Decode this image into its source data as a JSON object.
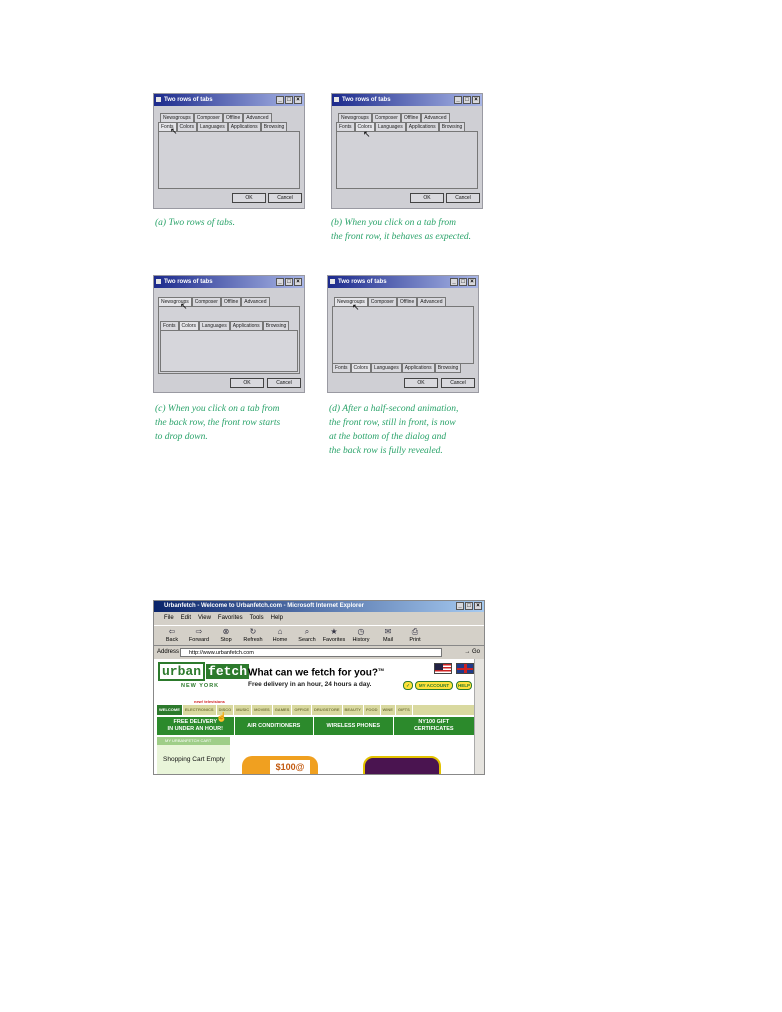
{
  "dialogs": [
    {
      "title": "Two rows of tabs",
      "back_row": [
        "Newsgroups",
        "Composer",
        "Offline",
        "Advanced"
      ],
      "front_row": [
        "Fonts",
        "Colors",
        "Languages",
        "Applications",
        "Browsing"
      ],
      "ok": "OK",
      "cancel": "Cancel",
      "caption": "(a) Two rows of tabs."
    },
    {
      "title": "Two rows of tabs",
      "back_row": [
        "Newsgroups",
        "Composer",
        "Offline",
        "Advanced"
      ],
      "front_row": [
        "Fonts",
        "Colors",
        "Languages",
        "Applications",
        "Browsing"
      ],
      "ok": "OK",
      "cancel": "Cancel",
      "caption": "(b) When you click on a tab from\nthe front row, it behaves as expected."
    },
    {
      "title": "Two rows of tabs",
      "back_row": [
        "Newsgroups",
        "Composer",
        "Offline",
        "Advanced"
      ],
      "front_row": [
        "Fonts",
        "Colors",
        "Languages",
        "Applications",
        "Browsing"
      ],
      "ok": "OK",
      "cancel": "Cancel",
      "caption": "(c) When you click on a tab from\nthe back row, the front row starts\nto drop down."
    },
    {
      "title": "Two rows of tabs",
      "back_row": [
        "Newsgroups",
        "Composer",
        "Offline",
        "Advanced"
      ],
      "front_row": [
        "Fonts",
        "Colors",
        "Languages",
        "Applications",
        "Browsing"
      ],
      "ok": "OK",
      "cancel": "Cancel",
      "caption": "(d) After a half-second animation,\nthe front row, still in front, is now\nat the bottom of the dialog and\nthe back row is fully revealed."
    }
  ],
  "browser": {
    "title": "Urbanfetch - Welcome to Urbanfetch.com - Microsoft Internet Explorer",
    "menu": [
      "File",
      "Edit",
      "View",
      "Favorites",
      "Tools",
      "Help"
    ],
    "toolbar": [
      {
        "label": "Back",
        "icon": "back-arrow-icon",
        "glyph": "⇦"
      },
      {
        "label": "Forward",
        "icon": "forward-arrow-icon",
        "glyph": "⇨"
      },
      {
        "label": "Stop",
        "icon": "stop-icon",
        "glyph": "⊗"
      },
      {
        "label": "Refresh",
        "icon": "refresh-icon",
        "glyph": "↻"
      },
      {
        "label": "Home",
        "icon": "home-icon",
        "glyph": "⌂"
      },
      {
        "label": "Search",
        "icon": "search-icon",
        "glyph": "⌕"
      },
      {
        "label": "Favorites",
        "icon": "favorites-icon",
        "glyph": "★"
      },
      {
        "label": "History",
        "icon": "history-icon",
        "glyph": "◷"
      },
      {
        "label": "Mail",
        "icon": "mail-icon",
        "glyph": "✉"
      },
      {
        "label": "Print",
        "icon": "print-icon",
        "glyph": "⎙"
      }
    ],
    "address_label": "Address",
    "address_value": "http://www.urbanfetch.com",
    "go_label": "Go",
    "page": {
      "logo_left": "urban",
      "logo_right": "fetch",
      "logo_sub": "NEW YORK",
      "headline": "What can we fetch for you?",
      "tm": "TM",
      "subline": "Free delivery in an hour, 24 hours a day.",
      "my_account": "MY ACCOUNT",
      "help": "HELP",
      "nav_items": [
        "WELCOME",
        "ELECTRONICS",
        "DISCO",
        "MUSIC",
        "MOVIES",
        "GAMES",
        "OFFICE",
        "DRUGSTORE",
        "BEAUTY",
        "FOOD",
        "WINE",
        "GIFTS"
      ],
      "new_label": "new! televisions",
      "promo": [
        "FREE DELIVERY\nIN UNDER AN HOUR!",
        "AIR CONDITIONERS",
        "WIRELESS PHONES",
        "NY100 GIFT\nCERTIFICATES"
      ],
      "sidebar_header": "MY URBANFETCH CART",
      "cart_text": "Shopping Cart Empty",
      "ad_text": "$100@"
    }
  },
  "colors": {
    "caption": "#2aa36a",
    "brand_green": "#2c7a2c"
  }
}
